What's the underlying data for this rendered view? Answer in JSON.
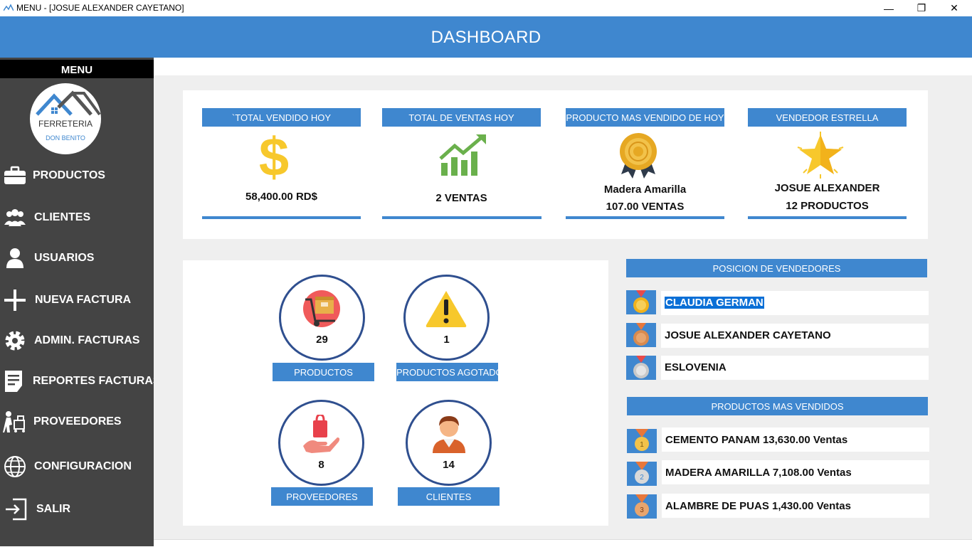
{
  "window": {
    "title": "MENU - [JOSUE ALEXANDER CAYETANO]",
    "minimize": "—",
    "restore": "❐",
    "close": "✕"
  },
  "header": {
    "title": "DASHBOARD"
  },
  "sidebar": {
    "menu_label": "MENU",
    "logo": {
      "line1": "FERRETERIA",
      "line2": "DON BENITO"
    },
    "items": [
      {
        "label": "PRODUCTOS",
        "icon": "briefcase-icon"
      },
      {
        "label": "CLIENTES",
        "icon": "users-icon"
      },
      {
        "label": "USUARIOS",
        "icon": "user-icon"
      },
      {
        "label": "NUEVA FACTURA",
        "icon": "plus-icon"
      },
      {
        "label": "ADMIN. FACTURAS",
        "icon": "gear-icon"
      },
      {
        "label": "REPORTES FACTURAS",
        "icon": "report-icon"
      },
      {
        "label": "PROVEEDORES",
        "icon": "delivery-icon"
      },
      {
        "label": "CONFIGURACION",
        "icon": "globe-icon"
      },
      {
        "label": "SALIR",
        "icon": "exit-icon"
      }
    ]
  },
  "stats": [
    {
      "title": "`TOTAL VENDIDO HOY",
      "line1": "58,400.00 RD$",
      "icon": "dollar-icon"
    },
    {
      "title": "TOTAL DE VENTAS HOY",
      "line1": "2  VENTAS",
      "icon": "growth-chart-icon"
    },
    {
      "title": "PRODUCTO MAS VENDIDO DE HOY",
      "line1": "Madera Amarilla",
      "line2": "107.00 VENTAS",
      "icon": "award-badge-icon"
    },
    {
      "title": "VENDEDOR ESTRELLA",
      "line1": "JOSUE ALEXANDER",
      "line2": "12  PRODUCTOS",
      "icon": "star-icon"
    }
  ],
  "tiles": [
    {
      "label": "PRODUCTOS",
      "count": "29",
      "icon": "package-cart-icon"
    },
    {
      "label": "PRODUCTOS AGOTADOS",
      "count": "1",
      "icon": "warning-icon"
    },
    {
      "label": "PROVEEDORES",
      "count": "8",
      "icon": "gift-hand-icon"
    },
    {
      "label": "CLIENTES",
      "count": "14",
      "icon": "customer-icon"
    }
  ],
  "sellers": {
    "title": "POSICION DE VENDEDORES",
    "rows": [
      {
        "name": "CLAUDIA GERMAN",
        "medal": "gold"
      },
      {
        "name": "JOSUE ALEXANDER CAYETANO",
        "medal": "bronze"
      },
      {
        "name": "ESLOVENIA",
        "medal": "silver"
      }
    ]
  },
  "top_products": {
    "title": "PRODUCTOS MAS VENDIDOS",
    "rows": [
      {
        "text": "CEMENTO PANAM   13,630.00 Ventas",
        "rank": "1"
      },
      {
        "text": "MADERA AMARILLA   7,108.00 Ventas",
        "rank": "2"
      },
      {
        "text": "ALAMBRE DE PUAS   1,430.00 Ventas",
        "rank": "3"
      }
    ]
  },
  "colors": {
    "accent": "#3f87cf",
    "sidebar": "#444444",
    "gold": "#f2b21b",
    "bronze": "#d98a4e",
    "silver": "#c9c9c9"
  }
}
